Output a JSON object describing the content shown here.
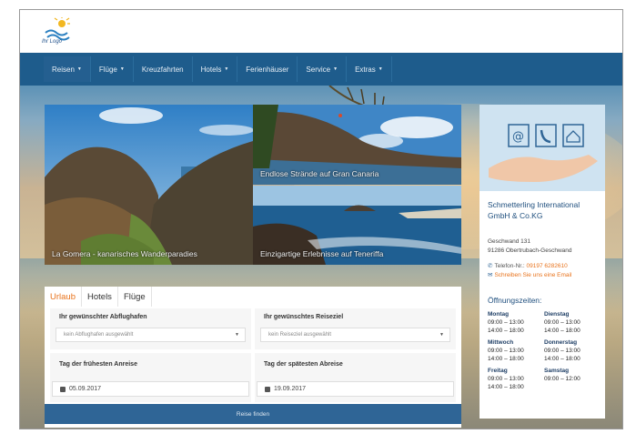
{
  "logo": {
    "text": "Ihr Logo"
  },
  "nav": {
    "items": [
      {
        "label": "Reisen",
        "dropdown": true
      },
      {
        "label": "Flüge",
        "dropdown": true
      },
      {
        "label": "Kreuzfahrten",
        "dropdown": false
      },
      {
        "label": "Hotels",
        "dropdown": true
      },
      {
        "label": "Ferienhäuser",
        "dropdown": false
      },
      {
        "label": "Service",
        "dropdown": true
      },
      {
        "label": "Extras",
        "dropdown": true
      }
    ],
    "caret": "▼"
  },
  "slides": [
    {
      "caption": "La Gomera - kanarisches Wanderparadies"
    },
    {
      "caption": "Endlose Strände auf Gran Canaria"
    },
    {
      "caption": "Einzigartige Erlebnisse auf Teneriffa"
    }
  ],
  "search": {
    "tabs": [
      "Urlaub",
      "Hotels",
      "Flüge"
    ],
    "active_tab": "Urlaub",
    "departure_label": "Ihr gewünschter Abflughafen",
    "departure_value": "kein Abflughafen ausgewählt",
    "destination_label": "Ihr gewünschtes Reiseziel",
    "destination_value": "kein Reiseziel ausgewählt",
    "earliest_label": "Tag der frühesten Anreise",
    "earliest_value": "05.09.2017",
    "latest_label": "Tag der spätesten Abreise",
    "latest_value": "19.09.2017",
    "submit_label": "Reise finden"
  },
  "sidebar": {
    "company_line1": "Schmetterling International",
    "company_line2": "GmbH & Co.KG",
    "street": "Geschwand 131",
    "city": "91286 Obertrubach-Geschwand",
    "phone_label": "Telefon-Nr.:",
    "phone": "09197 6282610",
    "email_label": "Schreiben Sie uns eine Email",
    "hours_title": "Öffnungszeiten:",
    "hours": [
      {
        "day": "Montag",
        "line1": "09:00 – 13:00",
        "line2": "14:00 – 18:00"
      },
      {
        "day": "Dienstag",
        "line1": "09:00 – 13:00",
        "line2": "14:00 – 18:00"
      },
      {
        "day": "Mittwoch",
        "line1": "09:00 – 13:00",
        "line2": "14:00 – 18:00"
      },
      {
        "day": "Donnerstag",
        "line1": "09:00 – 13:00",
        "line2": "14:00 – 18:00"
      },
      {
        "day": "Freitag",
        "line1": "09:00 – 13:00",
        "line2": "14:00 – 18:00"
      },
      {
        "day": "Samstag",
        "line1": "09:00 – 12:00",
        "line2": ""
      }
    ]
  },
  "colors": {
    "nav": "#1e5c8c",
    "accent": "#e8731c",
    "brand": "#1f4f7e"
  }
}
